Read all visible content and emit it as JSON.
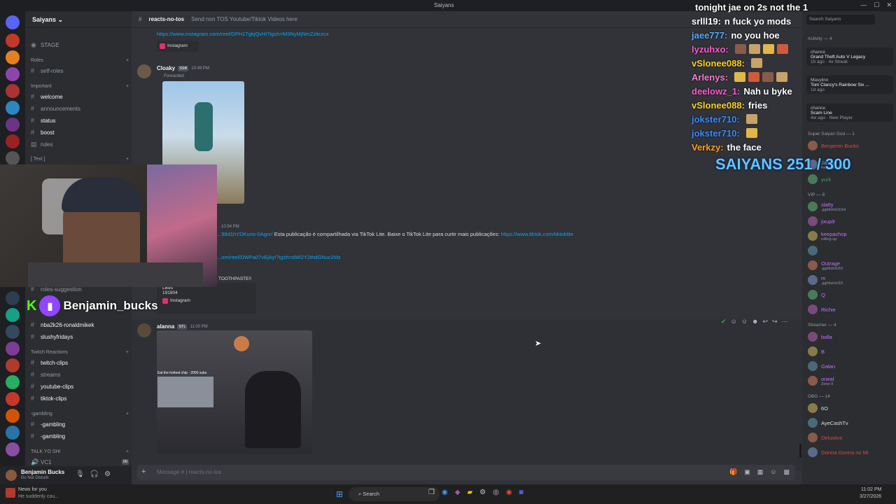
{
  "window": {
    "title": "Saiyans"
  },
  "server": {
    "name": "Saiyans",
    "stage_label": "STAGE",
    "categories": [
      {
        "label": "Roles"
      },
      {
        "label": "Important"
      },
      {
        "label": "[ Text ]"
      },
      {
        "label": "Twitch Reactions"
      },
      {
        "label": "-gambling"
      },
      {
        "label": "TALK YO SHI"
      }
    ],
    "channels": {
      "self_roles": "self-roles",
      "welcome": "welcome",
      "announcements": "announcements",
      "status": "status",
      "boost": "boost",
      "rules": "rules",
      "roles_suggestion": "roles-suggestion",
      "nba": "nba2k26-ronaldmikek",
      "slushy": "slushyfridays",
      "twitch_clips": "twitch-clips",
      "streams": "streams",
      "youtube_clips": "youtube-clips",
      "tiktok_clips": "tiktok-clips",
      "gambling1": "-gambling",
      "gambling2": "-gambling",
      "vc1": "VC1",
      "vc1_count": "00"
    }
  },
  "user": {
    "name": "Benjamin Bucks",
    "status": "Do Not Disturb"
  },
  "channel_header": {
    "name": "reacts-no-tos",
    "topic": "Send non TOS Youtube/Tiktok Videos here"
  },
  "messages": {
    "m1_link": "https://www.instagram.com/reel/DPH1TgkjQvH/?igsh=M3NyMjNmZzliczcx",
    "m1_embed": "Instagram",
    "m2_author": "Cloaky",
    "m2_badge": "SSB",
    "m2_time": "10:49 PM",
    "m2_forwarded": "Forwarded",
    "m3_time": "10:54 PM",
    "m3_link": "...98d1hYDKuno-0Agnr/",
    "m3_text": "Esta publicação é compartilhada via TikTok Lite. Baixe o TikTok Lite para curtir mais publicações:",
    "m3_link2": "https://www.tiktok.com/tiktoklite",
    "m4_link": "...om/reel/DWPa07vEjAy/?igsh=dWl2Y2thdGNuc2Mz",
    "m4_text": "TOOTHPASTE!!",
    "m4_likes_label": "Likes",
    "m4_likes": "191804",
    "m4_embed": "Instagram",
    "m5_author": "alanna",
    "m5_badge": "STL",
    "m5_time": "11:00 PM",
    "m5_caption": "Eat the hottest chip - 2000 subs"
  },
  "composer": {
    "placeholder": "Message # | reacts-no-tos"
  },
  "members": {
    "search_placeholder": "Search Saiyans",
    "activity_header": "Activity — 4",
    "activities": [
      {
        "user": "chance",
        "game": "Grand Theft Auto V Legacy",
        "meta": "1h ago · 4x Streak"
      },
      {
        "user": "Masylinx",
        "game": "Tom Clancy's Rainbow Six ...",
        "meta": "1d ago"
      },
      {
        "user": "chance",
        "game": "Scam Line",
        "meta": "4w ago · New Player"
      }
    ],
    "groups": [
      {
        "header": "Super Saiyan God — 1",
        "members": [
          {
            "name": "Benjamin Bucks",
            "color": "#e04545",
            "sub": ""
          }
        ]
      },
      {
        "header": "",
        "members": [
          {
            "name": "Jamiy",
            "color": "#5aa7ff",
            "sub": "free palestine"
          },
          {
            "name": "yurk",
            "color": "#3ba55d",
            "sub": ""
          }
        ]
      },
      {
        "header": "VIP — 8",
        "members": [
          {
            "name": "slatty",
            "color": "#c770ff",
            "sub": ".gg/district10sl"
          },
          {
            "name": "jixup9",
            "color": "#c770ff",
            "sub": ""
          },
          {
            "name": "keepachop",
            "color": "#c770ff",
            "sub": "rolling up"
          },
          {
            "name": "",
            "color": "#c770ff",
            "sub": ""
          },
          {
            "name": "Outrage",
            "color": "#c770ff",
            "sub": ".gg/district10"
          },
          {
            "name": "m",
            "color": "#c770ff",
            "sub": ".gg/district10"
          },
          {
            "name": "Q",
            "color": "#c770ff",
            "sub": ""
          },
          {
            "name": "Richie",
            "color": "#c770ff",
            "sub": ""
          }
        ]
      },
      {
        "header": "Streamer — 4",
        "members": [
          {
            "name": "balla",
            "color": "#c770ff",
            "sub": ""
          },
          {
            "name": "B",
            "color": "#c770ff",
            "sub": ""
          },
          {
            "name": "Galan",
            "color": "#c770ff",
            "sub": ""
          },
          {
            "name": "oneal",
            "color": "#c770ff",
            "sub": "Zone 9"
          }
        ]
      },
      {
        "header": "GBG — 14",
        "members": [
          {
            "name": "6O",
            "color": "#dbdee1",
            "sub": ""
          },
          {
            "name": "AyeCashTv",
            "color": "#dbdee1",
            "sub": ""
          },
          {
            "name": "Deluxiive",
            "color": "#e04545",
            "sub": ""
          },
          {
            "name": "Gonna Gonna no Mi",
            "color": "#e04545",
            "sub": ""
          }
        ]
      }
    ]
  },
  "stream_overlay": {
    "chat": [
      {
        "user": "",
        "user_color": "#ffffff",
        "text": "tonight jae on 2s not the 1"
      },
      {
        "user": "srlll19:",
        "user_color": "#ffffff",
        "text": "n fuck yo mods"
      },
      {
        "user": "jaee777:",
        "user_color": "#5aa7ff",
        "text": "no you hoe"
      },
      {
        "user": "lyzuhxo:",
        "user_color": "#ff5ad0",
        "text": ""
      },
      {
        "user": "vSlonee088:",
        "user_color": "#ffd21e",
        "text": ""
      },
      {
        "user": "Arlenys:",
        "user_color": "#ff7ad0",
        "text": ""
      },
      {
        "user": "deelowz_1:",
        "user_color": "#ff5ad0",
        "text": "Nah u byke"
      },
      {
        "user": "vSlonee088:",
        "user_color": "#ffd21e",
        "text": "fries"
      },
      {
        "user": "jokster710:",
        "user_color": "#3b8cff",
        "text": ""
      },
      {
        "user": "jokster710:",
        "user_color": "#3b8cff",
        "text": ""
      },
      {
        "user": "Verkzy:",
        "user_color": "#ffa21e",
        "text": "the face"
      }
    ],
    "counter": "SAIYANS 251 / 300",
    "streamer_name": "Benjamin_bucks"
  },
  "taskbar": {
    "news_title": "News for you",
    "news_sub": "He suddenly cou...",
    "search": "Search",
    "time": "11:02 PM",
    "date": "3/27/2026"
  }
}
